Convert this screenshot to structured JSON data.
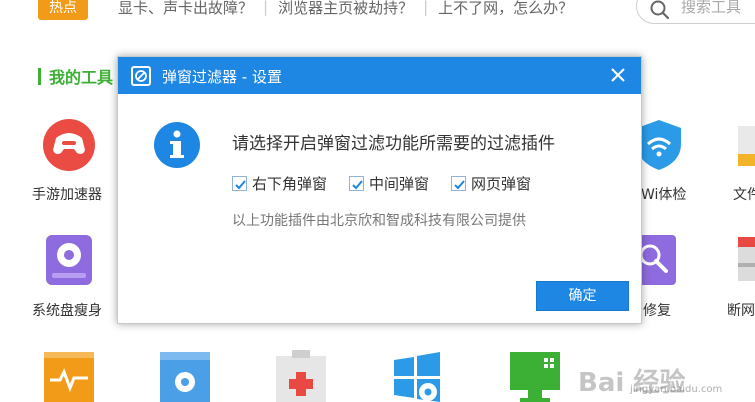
{
  "topbar": {
    "hot_badge": "热点",
    "links": [
      "显卡、声卡出故障？",
      "浏览器主页被劫持？",
      "上不了网，怎么办？"
    ],
    "search_placeholder": "搜索工具"
  },
  "section": {
    "title": "我的工具"
  },
  "tools": [
    {
      "label": "手游加速器",
      "icon": "gamepad-accelerator-icon"
    },
    {
      "label": "系统盘瘦身",
      "icon": "disk-slim-icon"
    },
    {
      "label": "Wi体检",
      "icon": "wifi-check-icon"
    },
    {
      "label": "文件",
      "icon": "folder-icon"
    },
    {
      "label": "修复",
      "icon": "magnifier-repair-icon"
    },
    {
      "label": "断网",
      "icon": "network-icon"
    },
    {
      "label": "",
      "icon": "heartbeat-box-icon"
    },
    {
      "label": "",
      "icon": "window-gear-icon"
    },
    {
      "label": "",
      "icon": "first-aid-kit-icon"
    },
    {
      "label": "",
      "icon": "windows-gear-icon"
    },
    {
      "label": "",
      "icon": "monitor-icon"
    }
  ],
  "dialog": {
    "title": "弹窗过滤器 - 设置",
    "message": "请选择开启弹窗过滤功能所需要的过滤插件",
    "options": [
      {
        "label": "右下角弹窗",
        "checked": true
      },
      {
        "label": "中间弹窗",
        "checked": true
      },
      {
        "label": "网页弹窗",
        "checked": true
      }
    ],
    "provider": "以上功能插件由北京欣和智成科技有限公司提供",
    "ok_label": "确定"
  },
  "watermark": {
    "text": "Bai 经验",
    "sub": "jingyan.baidu.com"
  },
  "colors": {
    "dialog_header": "#1e86e3",
    "accent_green": "#3cb034",
    "hot_badge": "#f29b18"
  }
}
